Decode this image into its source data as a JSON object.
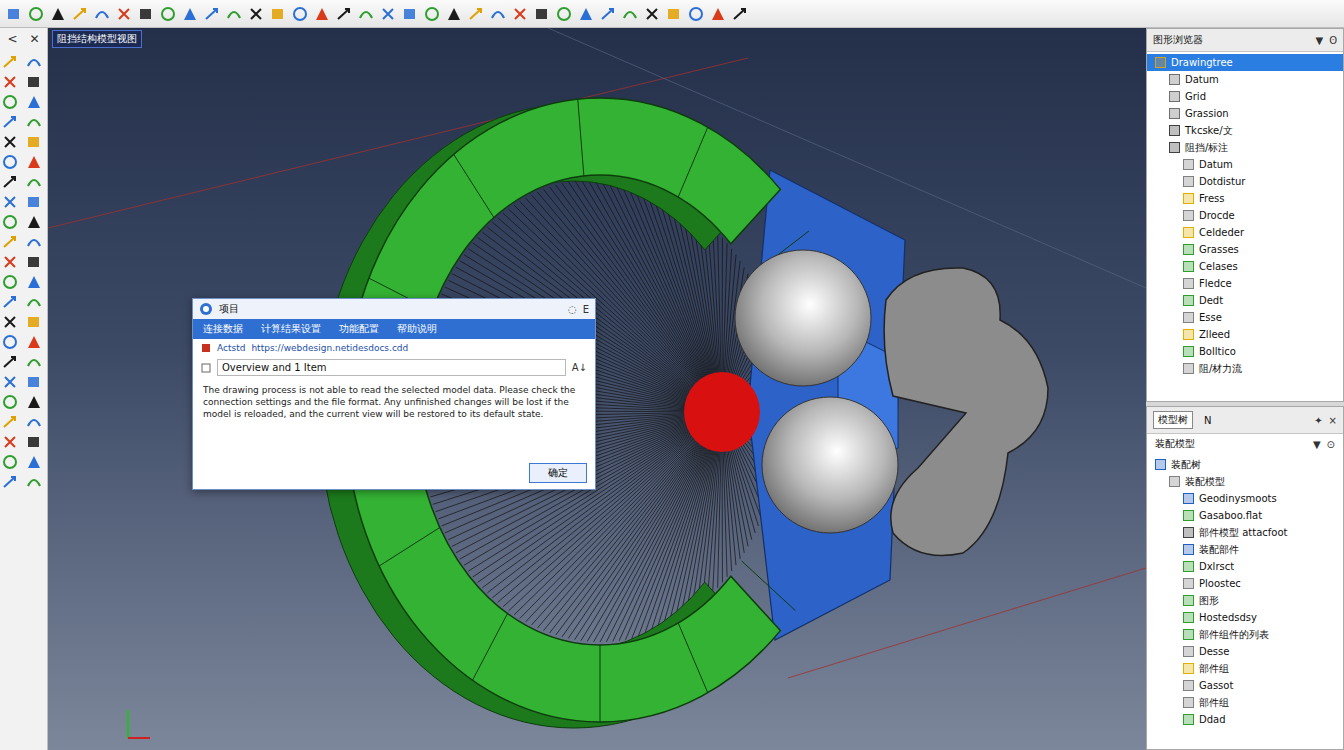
{
  "window": {
    "title": "阻挡结构模型视图"
  },
  "left_toolbar": {
    "header": [
      "<",
      "✕"
    ]
  },
  "dialog": {
    "title": "项目",
    "controls": [
      "◌",
      "E"
    ],
    "menu": [
      {
        "label": "连接数据",
        "selected": false
      },
      {
        "label": "计算结果设置",
        "selected": false
      },
      {
        "label": "功能配置",
        "selected": false
      },
      {
        "label": "帮助说明",
        "selected": false
      }
    ],
    "address": {
      "label": "Actstd",
      "url": "https://webdesign.netidesdocs.cdd"
    },
    "field": {
      "value": "Overview and 1 Item",
      "suffix": "A↓"
    },
    "body": "The drawing process is not able to read the selected model data. Please check the connection settings and the file format. Any unfinished changes will be lost if the model is reloaded, and the current view will be restored to its default state.",
    "buttons": [
      "确定"
    ]
  },
  "browser": {
    "title": "图形浏览器",
    "controls": [
      "▼",
      "ʘ"
    ],
    "items": [
      {
        "label": "Drawingtree",
        "selected": true,
        "depth": 0,
        "color": "#d8a020"
      },
      {
        "label": "Datum",
        "selected": false,
        "depth": 1,
        "color": "#707070"
      },
      {
        "label": "Grid",
        "selected": false,
        "depth": 1,
        "color": "#707070"
      },
      {
        "label": "Grassion",
        "selected": false,
        "depth": 1,
        "color": "#707070"
      },
      {
        "label": "Tkcske/文",
        "selected": false,
        "depth": 1,
        "color": "#404040"
      },
      {
        "label": "阻挡/标注",
        "selected": false,
        "depth": 1,
        "color": "#404040"
      },
      {
        "label": "Datum",
        "selected": false,
        "depth": 2,
        "color": "#808080"
      },
      {
        "label": "Dotdistur",
        "selected": false,
        "depth": 2,
        "color": "#808080"
      },
      {
        "label": "Fress",
        "selected": false,
        "depth": 2,
        "color": "#e0b000"
      },
      {
        "label": "Drocde",
        "selected": false,
        "depth": 2,
        "color": "#808080"
      },
      {
        "label": "Celdeder",
        "selected": false,
        "depth": 2,
        "color": "#e0b000"
      },
      {
        "label": "Grasses",
        "selected": false,
        "depth": 2,
        "color": "#2e9e2e"
      },
      {
        "label": "Celases",
        "selected": false,
        "depth": 2,
        "color": "#2e9e2e"
      },
      {
        "label": "Fledce",
        "selected": false,
        "depth": 2,
        "color": "#808080"
      },
      {
        "label": "Dedt",
        "selected": false,
        "depth": 2,
        "color": "#2e9e2e"
      },
      {
        "label": "Esse",
        "selected": false,
        "depth": 2,
        "color": "#808080"
      },
      {
        "label": "Zlleed",
        "selected": false,
        "depth": 2,
        "color": "#e0b000"
      },
      {
        "label": "Bolltico",
        "selected": false,
        "depth": 2,
        "color": "#2e9e2e"
      },
      {
        "label": "阻/材力流",
        "selected": false,
        "depth": 2,
        "color": "#808080"
      }
    ]
  },
  "model_tree": {
    "tabs": [
      {
        "label": "模型树",
        "selected": true
      },
      {
        "label": "N",
        "selected": false
      }
    ],
    "controls": [
      "✦",
      "×"
    ],
    "title": "装配模型",
    "title_controls": [
      "▼",
      "⊙"
    ],
    "items": [
      {
        "label": "装配树",
        "selected": false,
        "depth": 0,
        "color": "#2060c0"
      },
      {
        "label": "装配模型",
        "selected": false,
        "depth": 1,
        "color": "#808080"
      },
      {
        "label": "Geodinysmoots",
        "selected": false,
        "depth": 2,
        "color": "#2060c0"
      },
      {
        "label": "Gasaboo.flat",
        "selected": false,
        "depth": 2,
        "color": "#2e9e2e"
      },
      {
        "label": "部件模型 attacfoot",
        "selected": false,
        "depth": 2,
        "color": "#404040"
      },
      {
        "label": "装配部件",
        "selected": false,
        "depth": 2,
        "color": "#2060c0"
      },
      {
        "label": "Dxlrsct",
        "selected": false,
        "depth": 2,
        "color": "#2e9e2e"
      },
      {
        "label": "Ploostec",
        "selected": false,
        "depth": 2,
        "color": "#808080"
      },
      {
        "label": "图形",
        "selected": false,
        "depth": 2,
        "color": "#2e9e2e"
      },
      {
        "label": "Hostedsdsy",
        "selected": false,
        "depth": 2,
        "color": "#2e9e2e"
      },
      {
        "label": "部件组件的列表",
        "selected": false,
        "depth": 2,
        "color": "#2e9e2e"
      },
      {
        "label": "Desse",
        "selected": false,
        "depth": 2,
        "color": "#808080"
      },
      {
        "label": "部件组",
        "selected": false,
        "depth": 2,
        "color": "#e0b000"
      },
      {
        "label": "Gassot",
        "selected": false,
        "depth": 2,
        "color": "#808080"
      },
      {
        "label": "部件组",
        "selected": false,
        "depth": 2,
        "color": "#808080"
      },
      {
        "label": "Ddad",
        "selected": false,
        "depth": 2,
        "color": "#2e9e2e"
      }
    ]
  }
}
